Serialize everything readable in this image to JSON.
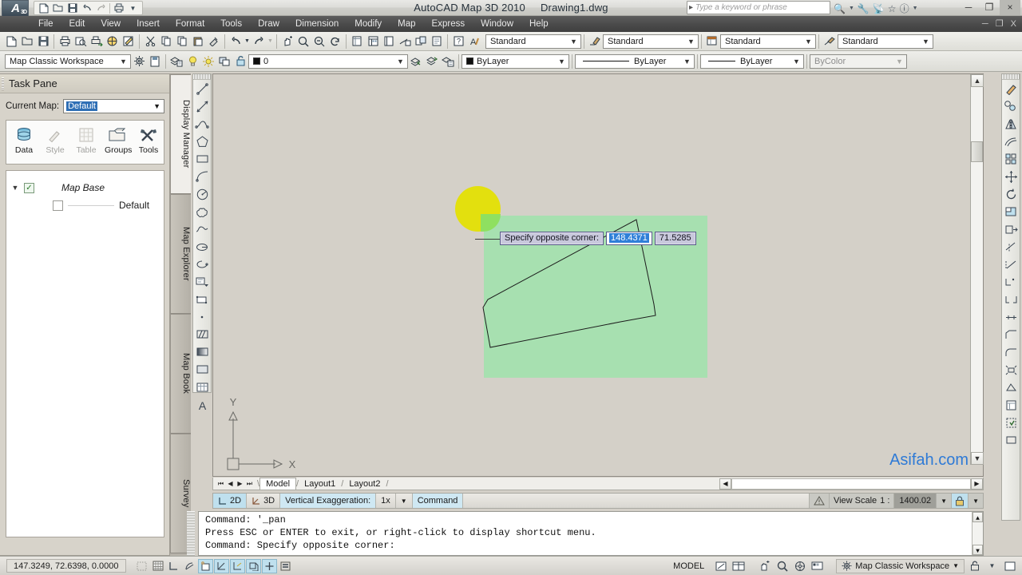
{
  "window": {
    "app_title": "AutoCAD Map 3D 2010",
    "document_title": "Drawing1.dwg",
    "logo_text": "A",
    "logo_sub": "3D",
    "search_placeholder": "Type a keyword or phrase",
    "minimize": "─",
    "maximize": "❐",
    "close": "×",
    "doc_minimize": "─",
    "doc_restore": "❐",
    "doc_close": "X"
  },
  "menu": {
    "items": [
      {
        "label": "File"
      },
      {
        "label": "Edit"
      },
      {
        "label": "View"
      },
      {
        "label": "Insert"
      },
      {
        "label": "Format"
      },
      {
        "label": "Tools"
      },
      {
        "label": "Draw"
      },
      {
        "label": "Dimension"
      },
      {
        "label": "Modify"
      },
      {
        "label": "Map"
      },
      {
        "label": "Express"
      },
      {
        "label": "Window"
      },
      {
        "label": "Help"
      }
    ]
  },
  "quick_access": {
    "icons": [
      "new-icon",
      "open-icon",
      "save-icon",
      "undo-icon",
      "redo-icon",
      "plot-icon",
      "customize-icon"
    ]
  },
  "standard_toolbar": {
    "style_combos": [
      {
        "name": "text-style",
        "value": "Standard"
      },
      {
        "name": "dimension-style",
        "value": "Standard"
      },
      {
        "name": "table-style",
        "value": "Standard"
      },
      {
        "name": "multileader-style",
        "value": "Standard"
      }
    ]
  },
  "workspace_toolbar": {
    "workspace_value": "Map Classic Workspace",
    "layer_value": "0",
    "color_value": "ByLayer",
    "linetype_value": "ByLayer",
    "lineweight_value": "ByLayer",
    "plotstyle_value": "ByColor"
  },
  "task_pane": {
    "title": "Task Pane",
    "current_map_label": "Current Map:",
    "current_map_value": "Default",
    "tools": [
      {
        "label": "Data",
        "icon": "data-cylinder-icon",
        "enabled": true
      },
      {
        "label": "Style",
        "icon": "style-brush-icon",
        "enabled": false
      },
      {
        "label": "Table",
        "icon": "table-grid-icon",
        "enabled": false
      },
      {
        "label": "Groups",
        "icon": "groups-folder-icon",
        "enabled": true
      },
      {
        "label": "Tools",
        "icon": "tools-hammer-icon",
        "enabled": true
      }
    ],
    "tree": {
      "root_label": "Map Base",
      "root_checked": true,
      "child_label": "Default",
      "child_checked": false
    },
    "vertical_tabs": [
      {
        "label": "Display Manager",
        "active": true
      },
      {
        "label": "Map Explorer",
        "active": false
      },
      {
        "label": "Map Book",
        "active": false
      },
      {
        "label": "Survey",
        "active": false
      }
    ]
  },
  "canvas": {
    "tooltip": {
      "prompt": "Specify opposite corner:",
      "x_value": "148.4371",
      "y_value": "71.5285"
    },
    "ucs": {
      "x_axis": "X",
      "y_axis": "Y"
    },
    "watermark": "Asifah.com",
    "colors": {
      "background": "#d4d0c8",
      "green_fill": "#a7e0b0",
      "yellow_circle": "#e3e00e",
      "green_circle_quad": "#8fe060",
      "tooltip_bg": "#c8c8dc",
      "tooltip_highlight": "#2f7fd8",
      "watermark": "#2e7ad6"
    }
  },
  "layout_tabs": {
    "nav": [
      "⏮",
      "◀",
      "▶",
      "⏭"
    ],
    "tabs": [
      {
        "label": "Model",
        "active": true
      },
      {
        "label": "Layout1",
        "active": false
      },
      {
        "label": "Layout2",
        "active": false
      }
    ]
  },
  "view_bar": {
    "mode_2d": "2D",
    "mode_3d": "3D",
    "vertical_exaggeration_label": "Vertical Exaggeration:",
    "vertical_exaggeration_value": "1x",
    "command_label": "Command",
    "view_scale_label": "View Scale",
    "view_scale_ratio": "1 :",
    "view_scale_value": "1400.02"
  },
  "command_line": {
    "lines": [
      "Command: '_pan",
      "Press ESC or ENTER to exit, or right-click to display shortcut menu.",
      "",
      "Command: Specify opposite corner:"
    ]
  },
  "status_bar": {
    "coordinates": "147.3249, 72.6398, 0.0000",
    "toggles": [
      {
        "name": "snap-mode",
        "icon": "snap-icon",
        "on": false
      },
      {
        "name": "grid-display",
        "icon": "grid-icon",
        "on": false
      },
      {
        "name": "ortho-mode",
        "icon": "ortho-icon",
        "on": false
      },
      {
        "name": "polar-tracking",
        "icon": "polar-icon",
        "on": false
      },
      {
        "name": "object-snap",
        "icon": "osnap-icon",
        "on": true
      },
      {
        "name": "object-snap-tracking",
        "icon": "otrack-icon",
        "on": true
      },
      {
        "name": "allow-ucs",
        "icon": "ucs-icon",
        "on": true
      },
      {
        "name": "dynamic-ucs",
        "icon": "dynucs-icon",
        "on": true
      },
      {
        "name": "dynamic-input",
        "icon": "dyninput-icon",
        "on": true
      },
      {
        "name": "show-lineweight",
        "icon": "lineweight-icon",
        "on": false
      }
    ],
    "space_label": "MODEL",
    "workspace_value": "Map Classic Workspace",
    "right_icons": [
      "pan-icon",
      "zoom-icon",
      "steering-wheel-icon",
      "showmotion-icon",
      "lock-icon",
      "clean-screen-icon"
    ]
  }
}
